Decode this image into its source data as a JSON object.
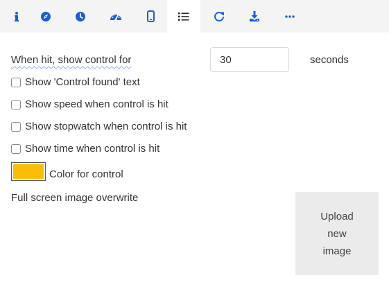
{
  "colors": {
    "accent": "#1b5fcf",
    "tab_bar_bg": "#f4f4f4",
    "control_color": "#fbbd08",
    "upload_bg": "#ebebeb"
  },
  "tabs": [
    {
      "icon": "info-icon",
      "active": false
    },
    {
      "icon": "compass-icon",
      "active": false
    },
    {
      "icon": "clock-icon",
      "active": false
    },
    {
      "icon": "speedometer-icon",
      "active": false
    },
    {
      "icon": "phone-icon",
      "active": false
    },
    {
      "icon": "list-icon",
      "active": true
    },
    {
      "icon": "refresh-icon",
      "active": false
    },
    {
      "icon": "download-icon",
      "active": false
    },
    {
      "icon": "more-icon",
      "active": false
    }
  ],
  "settings": {
    "hit_label": "When hit, show control for",
    "hit_seconds_value": "30",
    "seconds_label": "seconds",
    "checkboxes": [
      {
        "label": "Show 'Control found' text",
        "checked": false
      },
      {
        "label": "Show speed when control is hit",
        "checked": false
      },
      {
        "label": "Show stopwatch when control is hit",
        "checked": false
      },
      {
        "label": "Show time when control is hit",
        "checked": false
      }
    ],
    "color_label": "Color for control",
    "fullscreen_label": "Full screen image overwrite",
    "upload_label": "Upload\nnew\nimage"
  }
}
